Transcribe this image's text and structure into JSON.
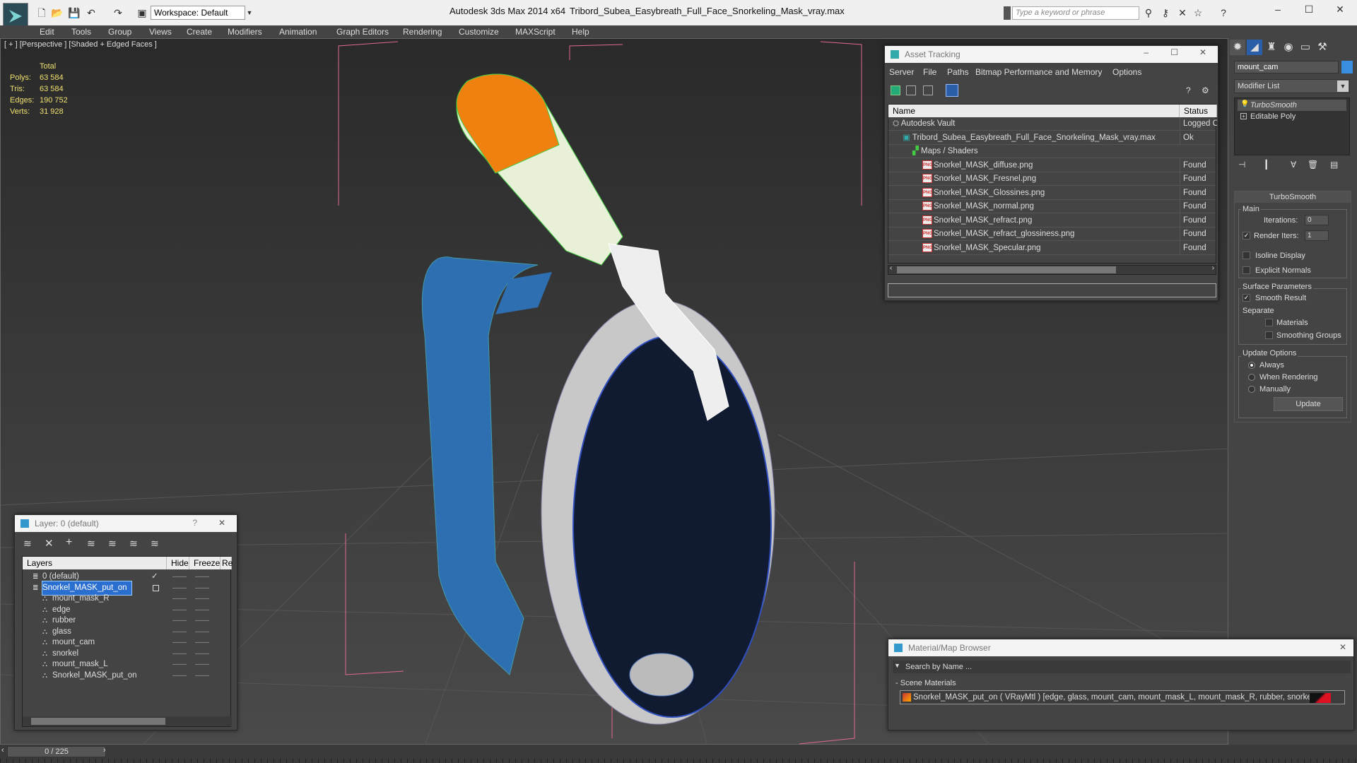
{
  "titlebar": {
    "workspace": "Workspace: Default",
    "app_title": "Autodesk 3ds Max  2014 x64",
    "file_title": "Tribord_Subea_Easybreath_Full_Face_Snorkeling_Mask_vray.max",
    "search_placeholder": "Type a keyword or phrase"
  },
  "menu": [
    "Edit",
    "Tools",
    "Group",
    "Views",
    "Create",
    "Modifiers",
    "Animation",
    "Graph Editors",
    "Rendering",
    "Customize",
    "MAXScript",
    "Help"
  ],
  "viewport": {
    "label": "[ + ] [Perspective ] [Shaded + Edged Faces ]",
    "stats": {
      "header": "Total",
      "polys_label": "Polys:",
      "polys": "63 584",
      "tris_label": "Tris:",
      "tris": "63 584",
      "edges_label": "Edges:",
      "edges": "190 752",
      "verts_label": "Verts:",
      "verts": "31 928"
    }
  },
  "asset_tracking": {
    "title": "Asset Tracking",
    "menu": [
      "Server",
      "File",
      "Paths",
      "Bitmap Performance and Memory",
      "Options"
    ],
    "col_name": "Name",
    "col_status": "Status",
    "rows": [
      {
        "name": "Autodesk Vault",
        "status": "Logged O",
        "indent": 0,
        "type": "vault"
      },
      {
        "name": "Tribord_Subea_Easybreath_Full_Face_Snorkeling_Mask_vray.max",
        "status": "Ok",
        "indent": 1,
        "type": "max"
      },
      {
        "name": "Maps / Shaders",
        "status": "",
        "indent": 2,
        "type": "maps"
      },
      {
        "name": "Snorkel_MASK_diffuse.png",
        "status": "Found",
        "indent": 3,
        "type": "png"
      },
      {
        "name": "Snorkel_MASK_Fresnel.png",
        "status": "Found",
        "indent": 3,
        "type": "png"
      },
      {
        "name": "Snorkel_MASK_Glossines.png",
        "status": "Found",
        "indent": 3,
        "type": "png"
      },
      {
        "name": "Snorkel_MASK_normal.png",
        "status": "Found",
        "indent": 3,
        "type": "png"
      },
      {
        "name": "Snorkel_MASK_refract.png",
        "status": "Found",
        "indent": 3,
        "type": "png"
      },
      {
        "name": "Snorkel_MASK_refract_glossiness.png",
        "status": "Found",
        "indent": 3,
        "type": "png"
      },
      {
        "name": "Snorkel_MASK_Specular.png",
        "status": "Found",
        "indent": 3,
        "type": "png"
      }
    ]
  },
  "layers": {
    "title": "Layer: 0 (default)",
    "help": "?",
    "col_layers": "Layers",
    "col_hide": "Hide",
    "col_freeze": "Freeze",
    "col_render": "Re",
    "rows": [
      {
        "name": "0 (default)",
        "indent": 0,
        "selected": false,
        "active": true
      },
      {
        "name": "Snorkel_MASK_put_on",
        "indent": 0,
        "selected": true,
        "active": false
      },
      {
        "name": "mount_mask_R",
        "indent": 1,
        "selected": false,
        "active": false
      },
      {
        "name": "edge",
        "indent": 1,
        "selected": false,
        "active": false
      },
      {
        "name": "rubber",
        "indent": 1,
        "selected": false,
        "active": false
      },
      {
        "name": "glass",
        "indent": 1,
        "selected": false,
        "active": false
      },
      {
        "name": "mount_cam",
        "indent": 1,
        "selected": false,
        "active": false
      },
      {
        "name": "snorkel",
        "indent": 1,
        "selected": false,
        "active": false
      },
      {
        "name": "mount_mask_L",
        "indent": 1,
        "selected": false,
        "active": false
      },
      {
        "name": "Snorkel_MASK_put_on",
        "indent": 1,
        "selected": false,
        "active": false
      }
    ]
  },
  "command_panel": {
    "object_name": "mount_cam",
    "object_color": "#3a8ee0",
    "modifier_list": "Modifier List",
    "stack": [
      "TurboSmooth",
      "Editable Poly"
    ],
    "turbosmooth": {
      "title": "TurboSmooth",
      "main": "Main",
      "iterations_label": "Iterations:",
      "iterations": "0",
      "render_iters_label": "Render Iters:",
      "render_iters": "1",
      "isoline": "Isoline Display",
      "explicit_normals": "Explicit Normals",
      "surface_params": "Surface Parameters",
      "smooth_result": "Smooth Result",
      "separate": "Separate",
      "materials": "Materials",
      "smoothing_groups": "Smoothing Groups",
      "update_options": "Update Options",
      "always": "Always",
      "when_rendering": "When Rendering",
      "manually": "Manually",
      "update": "Update"
    }
  },
  "material_browser": {
    "title": "Material/Map Browser",
    "search_placeholder": "Search by Name ...",
    "section": "Scene Materials",
    "material": "Snorkel_MASK_put_on  ( VRayMtl ) [edge, glass, mount_cam, mount_mask_L, mount_mask_R, rubber, snorkel]"
  },
  "timeline": {
    "frame": "0 / 225"
  }
}
